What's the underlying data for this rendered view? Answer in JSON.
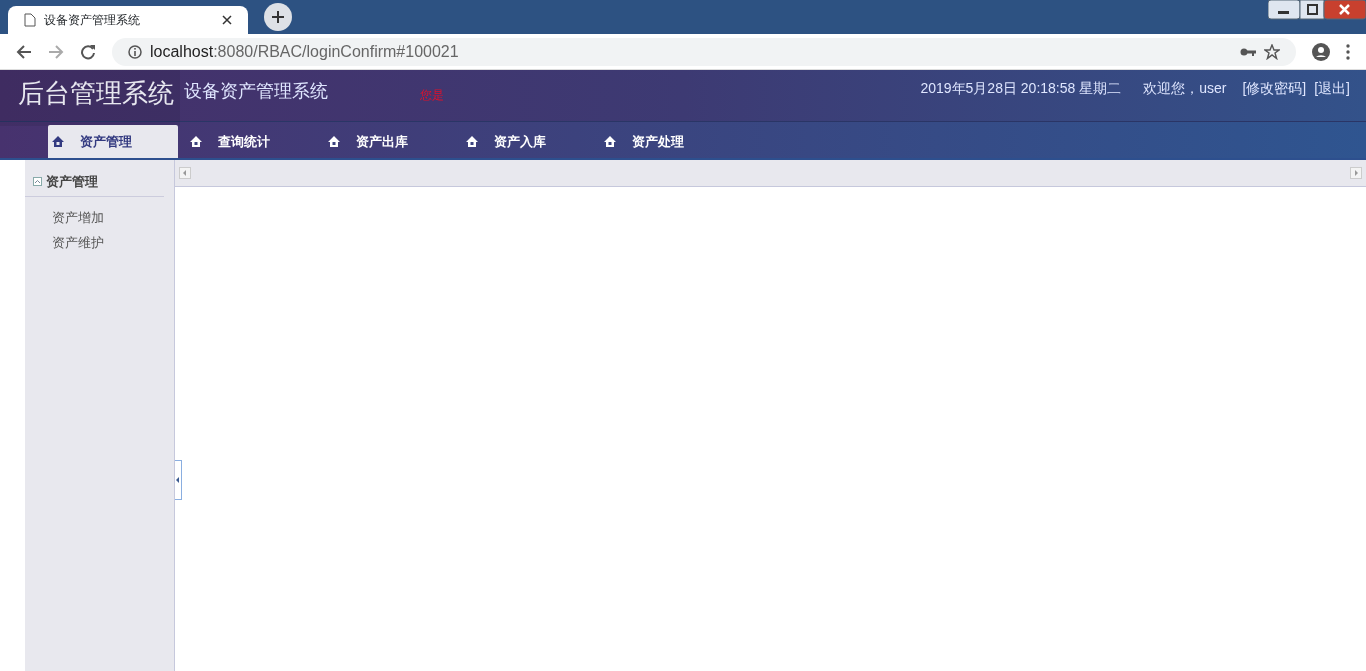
{
  "browser": {
    "tab_title": "设备资产管理系统",
    "url_host": "localhost",
    "url_rest": ":8080/RBAC/loginConfirm#100021"
  },
  "header": {
    "logo": "后台管理系统",
    "subtitle": "设备资产管理系统",
    "notice": "您是",
    "datetime": "2019年5月28日 20:18:58 星期二",
    "welcome": "欢迎您，user",
    "links": [
      "[修改密码]",
      "[退出]"
    ]
  },
  "nav_tabs": [
    {
      "label": "资产管理",
      "selected": true
    },
    {
      "label": "查询统计",
      "selected": false
    },
    {
      "label": "资产出库",
      "selected": false
    },
    {
      "label": "资产入库",
      "selected": false
    },
    {
      "label": "资产处理",
      "selected": false
    }
  ],
  "sidebar": {
    "title": "资产管理",
    "expanded": true,
    "items": [
      "资产增加",
      "资产维护"
    ]
  }
}
